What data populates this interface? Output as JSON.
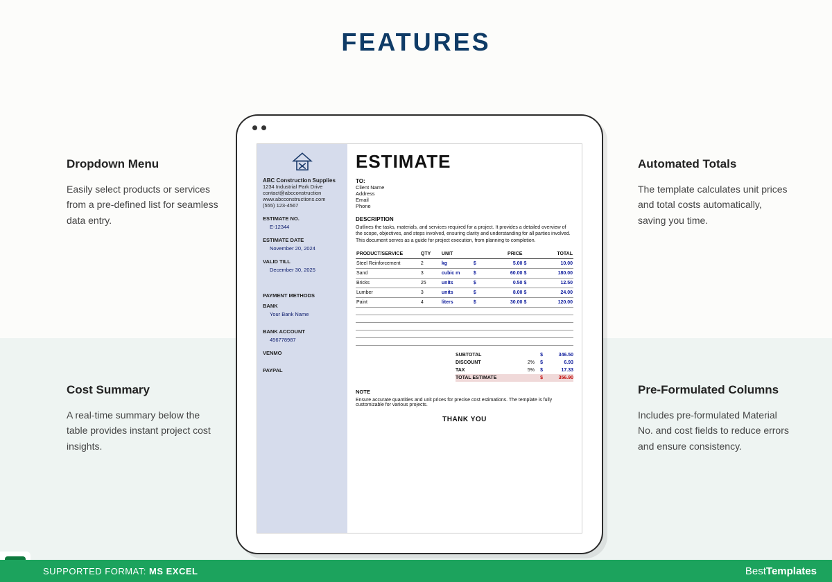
{
  "page_title": "FEATURES",
  "features": {
    "f1": {
      "title": "Dropdown Menu",
      "body": "Easily select products or services from a pre-defined list for seamless data entry."
    },
    "f2": {
      "title": "Automated Totals",
      "body": "The template calculates unit prices and total costs automatically, saving you time."
    },
    "f3": {
      "title": "Cost Summary",
      "body": "A real-time summary below the table provides instant project cost insights."
    },
    "f4": {
      "title": "Pre-Formulated Columns",
      "body": "Includes pre-formulated Material No. and cost fields to reduce errors and ensure consistency."
    }
  },
  "doc": {
    "company": {
      "name": "ABC Construction Supplies",
      "addr": "1234 Industrial Park Drive",
      "email": "contact@abcconstruction",
      "web": "www.abcconstructions.com",
      "phone": "(555) 123-4567"
    },
    "labels": {
      "est_no": "ESTIMATE NO.",
      "est_date": "ESTIMATE DATE",
      "valid": "VALID TILL",
      "pay": "PAYMENT METHODS",
      "bank": "BANK",
      "acct": "BANK ACCOUNT",
      "venmo": "VENMO",
      "paypal": "PAYPAL",
      "to": "TO:",
      "client": "Client Name",
      "addr": "Address",
      "email": "Email",
      "phone": "Phone",
      "desc": "DESCRIPTION",
      "note": "NOTE",
      "thank": "THANK YOU"
    },
    "est_no": "E-12344",
    "est_date": "November 20, 2024",
    "valid": "December 30, 2025",
    "bank_name": "Your Bank Name",
    "acct": "456778987",
    "heading": "ESTIMATE",
    "desc_text": "Outlines the tasks, materials, and services required for a project. It provides a detailed overview of the scope, objectives, and steps involved, ensuring clarity and understanding for all parties involved. This document serves as a guide for project execution, from planning to completion.",
    "cols": {
      "ps": "PRODUCT/SERVICE",
      "qty": "QTY",
      "unit": "UNIT",
      "price": "PRICE",
      "total": "TOTAL"
    },
    "items": [
      {
        "name": "Steel Reinforcement",
        "qty": "2",
        "unit": "kg",
        "price": "5.00",
        "total": "10.00"
      },
      {
        "name": "Sand",
        "qty": "3",
        "unit": "cubic m",
        "price": "60.00",
        "total": "180.00"
      },
      {
        "name": "Bricks",
        "qty": "25",
        "unit": "units",
        "price": "0.50",
        "total": "12.50"
      },
      {
        "name": "Lumber",
        "qty": "3",
        "unit": "units",
        "price": "8.00",
        "total": "24.00"
      },
      {
        "name": "Paint",
        "qty": "4",
        "unit": "liters",
        "price": "30.00",
        "total": "120.00"
      }
    ],
    "totals": {
      "subtotal_l": "SUBTOTAL",
      "subtotal": "346.50",
      "discount_l": "DISCOUNT",
      "discount_p": "2%",
      "discount": "6.93",
      "tax_l": "TAX",
      "tax_p": "5%",
      "tax": "17.33",
      "final_l": "TOTAL ESTIMATE",
      "final": "356.90"
    },
    "note_text": "Ensure accurate quantities and unit prices for precise cost estimations. The template is fully customizable for various projects."
  },
  "footer": {
    "supported_pre": "SUPPORTED FORMAT: ",
    "supported": "MS EXCEL",
    "brand_pre": "Best",
    "brand_post": "Templates"
  }
}
